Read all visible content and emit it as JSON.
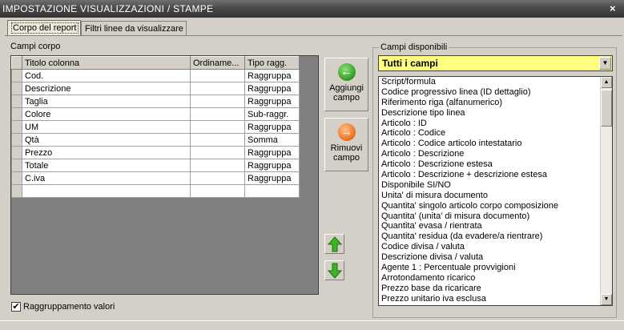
{
  "window": {
    "title": "IMPOSTAZIONE VISUALIZZAZIONI / STAMPE",
    "close_glyph": "×"
  },
  "tabs": [
    {
      "label": "Corpo del report",
      "active": true
    },
    {
      "label": "Filtri linee da visualizzare",
      "active": false
    }
  ],
  "campi_corpo": {
    "label": "Campi corpo",
    "columns": [
      "Titolo colonna",
      "Ordiname...",
      "Tipo ragg."
    ],
    "rows": [
      [
        "Cod.",
        "",
        "Raggruppa"
      ],
      [
        "Descrizione",
        "",
        "Raggruppa"
      ],
      [
        "Taglia",
        "",
        "Raggruppa"
      ],
      [
        "Colore",
        "",
        "Sub-raggr."
      ],
      [
        "UM",
        "",
        "Raggruppa"
      ],
      [
        "Qtà",
        "",
        "Somma"
      ],
      [
        "Prezzo",
        "",
        "Raggruppa"
      ],
      [
        "Totale",
        "",
        "Raggruppa"
      ],
      [
        "C.iva",
        "",
        "Raggruppa"
      ],
      [
        "",
        "",
        ""
      ]
    ]
  },
  "actions": {
    "add_label_1": "Aggiungi",
    "add_label_2": "campo",
    "remove_label_1": "Rimuovi",
    "remove_label_2": "campo"
  },
  "checkbox": {
    "label": "Raggruppamento valori",
    "checked": true
  },
  "campi_disponibili": {
    "label": "Campi disponibili",
    "selected_filter": "Tutti i campi",
    "items": [
      "Script/formula",
      "Codice progressivo linea (ID dettaglio)",
      "Riferimento riga (alfanumerico)",
      "Descrizione tipo linea",
      "Articolo : ID",
      "Articolo : Codice",
      "Articolo : Codice articolo intestatario",
      "Articolo : Descrizione",
      "Articolo : Descrizione estesa",
      "Articolo : Descrizione + descrizione estesa",
      "Disponibile SI/NO",
      "Unita' di misura documento",
      "Quantita' singolo articolo corpo composizione",
      "Quantita' (unita' di misura documento)",
      "Quantita' evasa / rientrata",
      "Quantita' residua (da evadere/a rientrare)",
      "Codice divisa / valuta",
      "Descrizione divisa / valuta",
      "Agente 1 : Percentuale provvigioni",
      "Arrotondamento ricarico",
      "Prezzo base da ricaricare",
      "Prezzo unitario iva esclusa"
    ]
  },
  "colors": {
    "filter_bg": "#ffff80",
    "add_icon": "#2e9b1d",
    "remove_icon": "#f06a1d",
    "title_bar": "#4a4a4a"
  }
}
